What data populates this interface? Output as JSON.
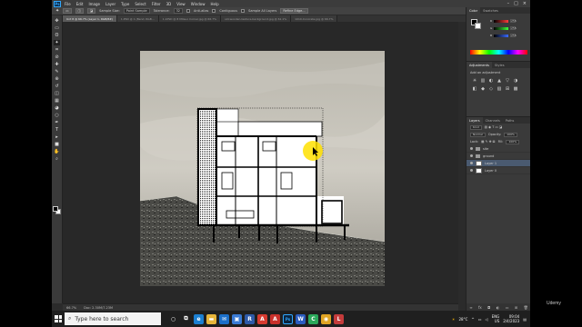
{
  "app": {
    "logo": "Ps",
    "menu": [
      "File",
      "Edit",
      "Image",
      "Layer",
      "Type",
      "Select",
      "Filter",
      "3D",
      "View",
      "Window",
      "Help"
    ]
  },
  "options": {
    "sample_size_label": "Sample Size:",
    "sample_size_value": "Point Sample",
    "tolerance_label": "Tolerance:",
    "tolerance_value": "32",
    "anti_alias": "Anti-alias",
    "contiguous": "Contiguous",
    "sample_all": "Sample All Layers",
    "refine_edge": "Refine Edge..."
  },
  "doc_tabs": [
    "Unt 8 @ 66.7% (Layer 1, RGB/8#)",
    "1.PSD @ 1 (Bend, RGB...",
    "1.1PSD @ 8 Mitsuo Corner.jpg @ 66.7%",
    "old-wooden-texture-background.jpg @ 61.1%",
    "1010-Concrete.jpg @ 66.7%"
  ],
  "tools": [
    "move-icon",
    "marquee-icon",
    "lasso-icon",
    "magic-wand-icon",
    "crop-icon",
    "eyedropper-icon",
    "healing-icon",
    "brush-icon",
    "stamp-icon",
    "history-brush-icon",
    "eraser-icon",
    "gradient-icon",
    "blur-icon",
    "dodge-icon",
    "pen-icon",
    "type-icon",
    "path-select-icon",
    "shape-icon",
    "hand-icon",
    "zoom-icon"
  ],
  "tool_glyphs": [
    "✥",
    "▭",
    "ʘ",
    "✦",
    "⌗",
    "⊘",
    "✚",
    "✎",
    "⊕",
    "↺",
    "◫",
    "▦",
    "◕",
    "○",
    "✒",
    "T",
    "▸",
    "■",
    "✋",
    "⌕"
  ],
  "status": {
    "zoom": "66.7%",
    "doc_info": "Doc: 2.30M/7.23M"
  },
  "panels": {
    "color_tabs": [
      "Color",
      "Swatches"
    ],
    "rgb": [
      {
        "label": "R",
        "value": "255",
        "color": "#ff3b3b"
      },
      {
        "label": "G",
        "value": "255",
        "color": "#3bff3b"
      },
      {
        "label": "B",
        "value": "255",
        "color": "#3b6bff"
      }
    ],
    "adj_tabs": [
      "Adjustments",
      "Styles"
    ],
    "adj_title": "Add an adjustment",
    "adj_icons": [
      "☀",
      "▥",
      "◐",
      "▲",
      "▽",
      "◑",
      "◧",
      "◆",
      "◇",
      "▧",
      "⊞",
      "▩"
    ],
    "layers_tabs": [
      "Layers",
      "Channels",
      "Paths"
    ],
    "kind_label": "Kind",
    "blend_mode": "Normal",
    "opacity_label": "Opacity:",
    "opacity_value": "100%",
    "lock_label": "Lock:",
    "fill_label": "Fill:",
    "fill_value": "100%",
    "layers": [
      {
        "name": "site",
        "type": "folder"
      },
      {
        "name": "ground",
        "type": "folder"
      },
      {
        "name": "Layer 1",
        "type": "layer",
        "selected": true
      },
      {
        "name": "Layer 0",
        "type": "layer"
      }
    ]
  },
  "watermark": "Udemy",
  "taskbar": {
    "search_placeholder": "Type here to search",
    "apps": [
      {
        "icon": "cortana-icon",
        "glyph": "○",
        "color": "#1f1f1f"
      },
      {
        "icon": "task-view-icon",
        "glyph": "⧉",
        "color": "#1f1f1f"
      },
      {
        "icon": "edge-icon",
        "glyph": "e",
        "color": "#1b7fd1"
      },
      {
        "icon": "file-explorer-icon",
        "glyph": "▬",
        "color": "#e7b53a"
      },
      {
        "icon": "mail-icon",
        "glyph": "✉",
        "color": "#1b6fc9"
      },
      {
        "icon": "store-icon",
        "glyph": "▣",
        "color": "#3a7bd5"
      },
      {
        "icon": "revit-icon",
        "glyph": "R",
        "color": "#2e5aa8"
      },
      {
        "icon": "acrobat-icon",
        "glyph": "A",
        "color": "#d63a2f"
      },
      {
        "icon": "autocad-icon",
        "glyph": "A",
        "color": "#c8302b"
      },
      {
        "icon": "photoshop-icon",
        "glyph": "Ps",
        "color": "#0a2540"
      },
      {
        "icon": "word-icon",
        "glyph": "W",
        "color": "#2b5cbf"
      },
      {
        "icon": "camtasia-icon",
        "glyph": "C",
        "color": "#2aa85a"
      },
      {
        "icon": "chrome-icon",
        "glyph": "◉",
        "color": "#e0a423"
      },
      {
        "icon": "lumion-icon",
        "glyph": "L",
        "color": "#c43b3b"
      }
    ],
    "weather": "28°C",
    "lang_top": "ENG",
    "lang_bottom": "US",
    "time": "09:04",
    "date": "2/4/2023"
  }
}
